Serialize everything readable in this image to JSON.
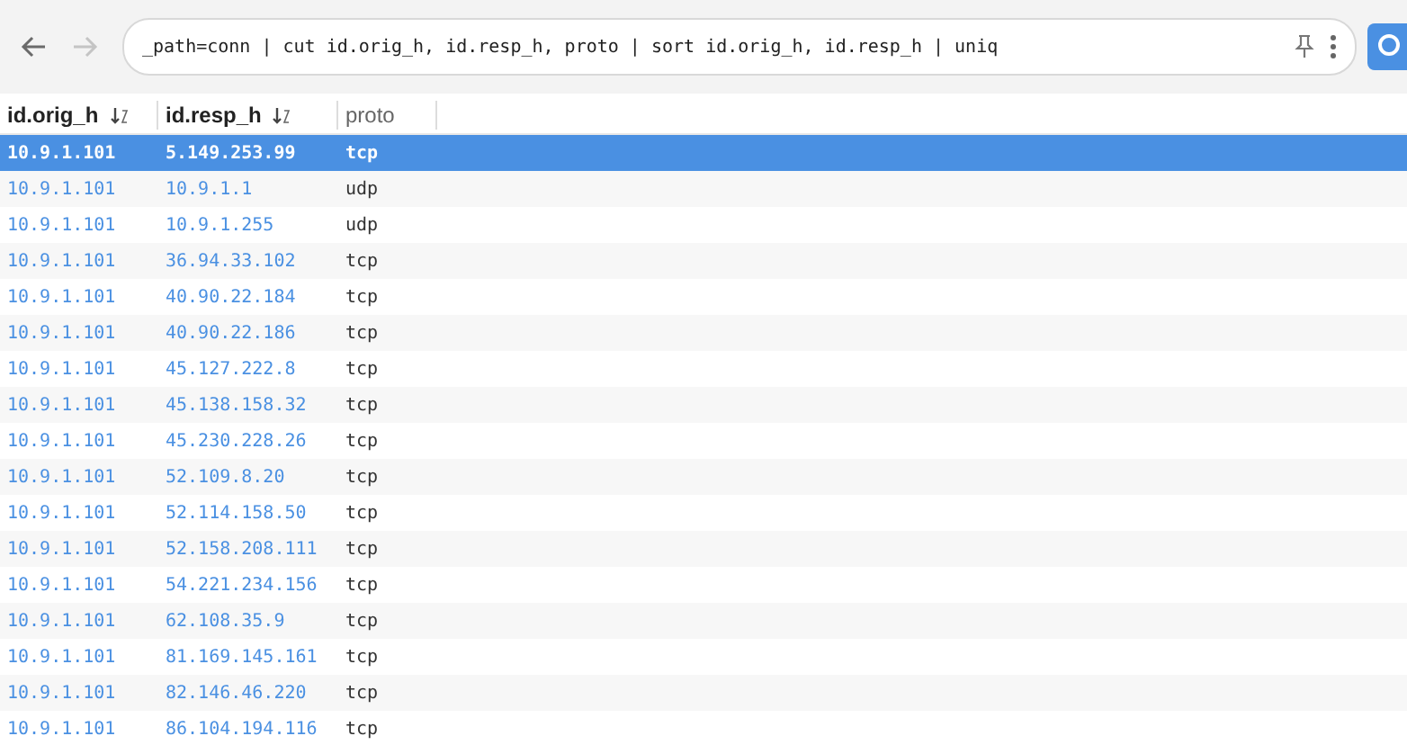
{
  "toolbar": {
    "back": {
      "disabled": false
    },
    "forward": {
      "disabled": true
    },
    "query": "_path=conn | cut id.orig_h, id.resp_h, proto | sort id.orig_h, id.resp_h | uniq"
  },
  "table": {
    "columns": [
      {
        "label": "id.orig_h",
        "sorted": true
      },
      {
        "label": "id.resp_h",
        "sorted": true
      },
      {
        "label": "proto",
        "sorted": false
      }
    ],
    "rows": [
      {
        "cells": [
          "10.9.1.101",
          "5.149.253.99",
          "tcp"
        ],
        "selected": true
      },
      {
        "cells": [
          "10.9.1.101",
          "10.9.1.1",
          "udp"
        ],
        "selected": false
      },
      {
        "cells": [
          "10.9.1.101",
          "10.9.1.255",
          "udp"
        ],
        "selected": false
      },
      {
        "cells": [
          "10.9.1.101",
          "36.94.33.102",
          "tcp"
        ],
        "selected": false
      },
      {
        "cells": [
          "10.9.1.101",
          "40.90.22.184",
          "tcp"
        ],
        "selected": false
      },
      {
        "cells": [
          "10.9.1.101",
          "40.90.22.186",
          "tcp"
        ],
        "selected": false
      },
      {
        "cells": [
          "10.9.1.101",
          "45.127.222.8",
          "tcp"
        ],
        "selected": false
      },
      {
        "cells": [
          "10.9.1.101",
          "45.138.158.32",
          "tcp"
        ],
        "selected": false
      },
      {
        "cells": [
          "10.9.1.101",
          "45.230.228.26",
          "tcp"
        ],
        "selected": false
      },
      {
        "cells": [
          "10.9.1.101",
          "52.109.8.20",
          "tcp"
        ],
        "selected": false
      },
      {
        "cells": [
          "10.9.1.101",
          "52.114.158.50",
          "tcp"
        ],
        "selected": false
      },
      {
        "cells": [
          "10.9.1.101",
          "52.158.208.111",
          "tcp"
        ],
        "selected": false
      },
      {
        "cells": [
          "10.9.1.101",
          "54.221.234.156",
          "tcp"
        ],
        "selected": false
      },
      {
        "cells": [
          "10.9.1.101",
          "62.108.35.9",
          "tcp"
        ],
        "selected": false
      },
      {
        "cells": [
          "10.9.1.101",
          "81.169.145.161",
          "tcp"
        ],
        "selected": false
      },
      {
        "cells": [
          "10.9.1.101",
          "82.146.46.220",
          "tcp"
        ],
        "selected": false
      },
      {
        "cells": [
          "10.9.1.101",
          "86.104.194.116",
          "tcp"
        ],
        "selected": false
      }
    ]
  }
}
